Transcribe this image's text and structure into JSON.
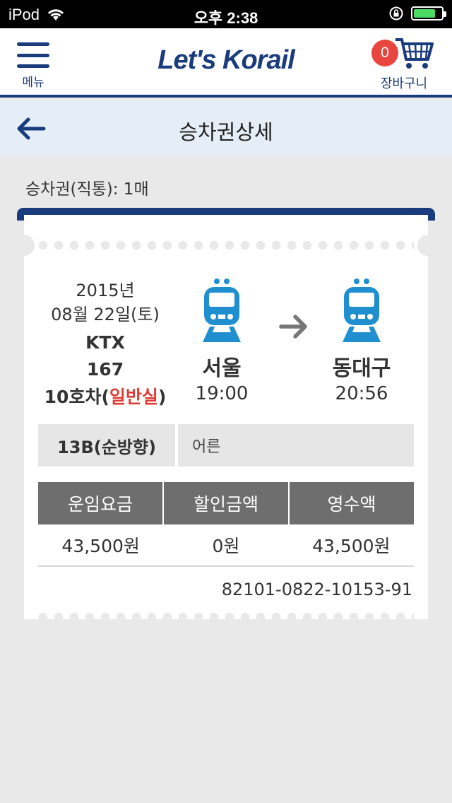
{
  "status_bar": {
    "carrier": "iPod",
    "time": "오후 2:38"
  },
  "header": {
    "menu_label": "메뉴",
    "logo_text": "Let's Korail",
    "cart_count": "0",
    "cart_label": "장바구니"
  },
  "subheader": {
    "title": "승차권상세"
  },
  "ticket_summary": "승차권(직통): 1매",
  "ticket": {
    "date_year": "2015년",
    "date_day": "08월 22일(토)",
    "train_name": "KTX",
    "train_number": "167",
    "car_prefix": "10호차(",
    "car_class": "일반실",
    "car_suffix": ")",
    "departure": {
      "station": "서울",
      "time": "19:00"
    },
    "arrival": {
      "station": "동대구",
      "time": "20:56"
    },
    "seat": "13B(순방향)",
    "passenger_type": "어른",
    "fare_headers": [
      "운임요금",
      "할인금액",
      "영수액"
    ],
    "fare_values": [
      "43,500원",
      "0원",
      "43,500원"
    ],
    "ticket_number": "82101-0822-10153-91"
  },
  "colors": {
    "brand_navy": "#1a3c7c",
    "train_blue": "#1f8fd0",
    "accent_red": "#e03c36",
    "badge_red": "#e8463e",
    "battery_green": "#4cd964"
  }
}
